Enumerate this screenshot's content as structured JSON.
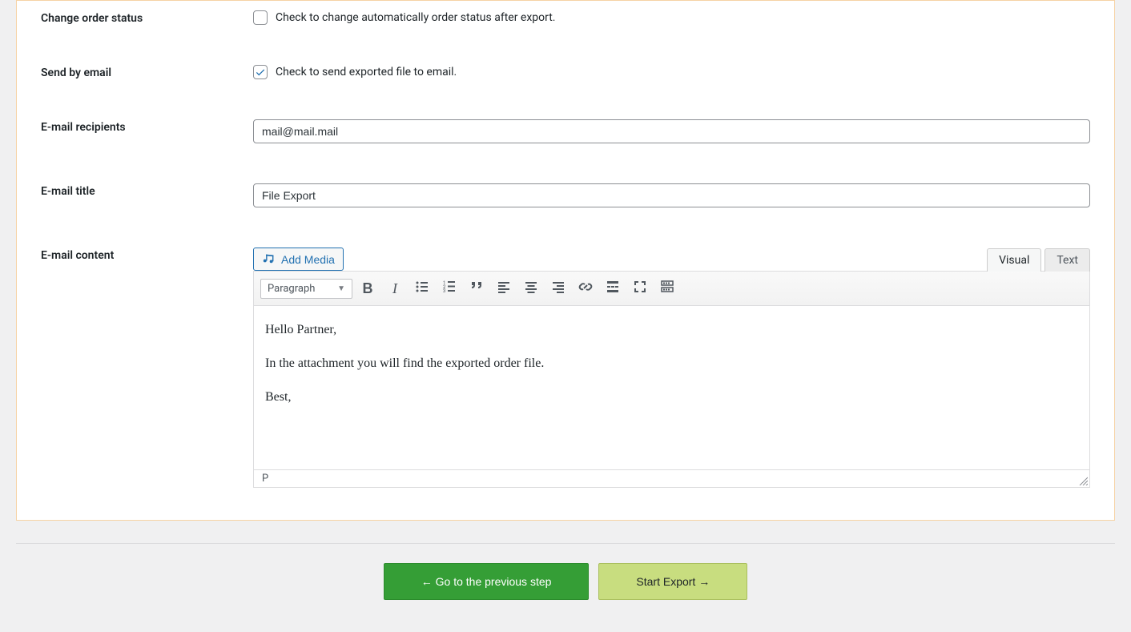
{
  "rows": {
    "change_status": {
      "label": "Change order status",
      "checked": false,
      "text": "Check to change automatically order status after export."
    },
    "send_email": {
      "label": "Send by email",
      "checked": true,
      "text": "Check to send exported file to email."
    },
    "recipients": {
      "label": "E-mail recipients",
      "value": "mail@mail.mail"
    },
    "title": {
      "label": "E-mail title",
      "value": "File Export"
    },
    "content": {
      "label": "E-mail content"
    }
  },
  "editor": {
    "add_media": "Add Media",
    "tabs": {
      "visual": "Visual",
      "text": "Text",
      "active": "visual"
    },
    "format": "Paragraph",
    "body": {
      "p1": "Hello Partner,",
      "p2": "In the attachment you will find the exported order file.",
      "p3": "Best,"
    },
    "status": "P"
  },
  "buttons": {
    "prev": "← Go to the previous step",
    "start": "Start Export →"
  },
  "colors": {
    "primary_link": "#2271b1",
    "prev_btn": "#359e36",
    "start_btn": "#c8dd7f",
    "panel_border": "#f6d3a5"
  }
}
